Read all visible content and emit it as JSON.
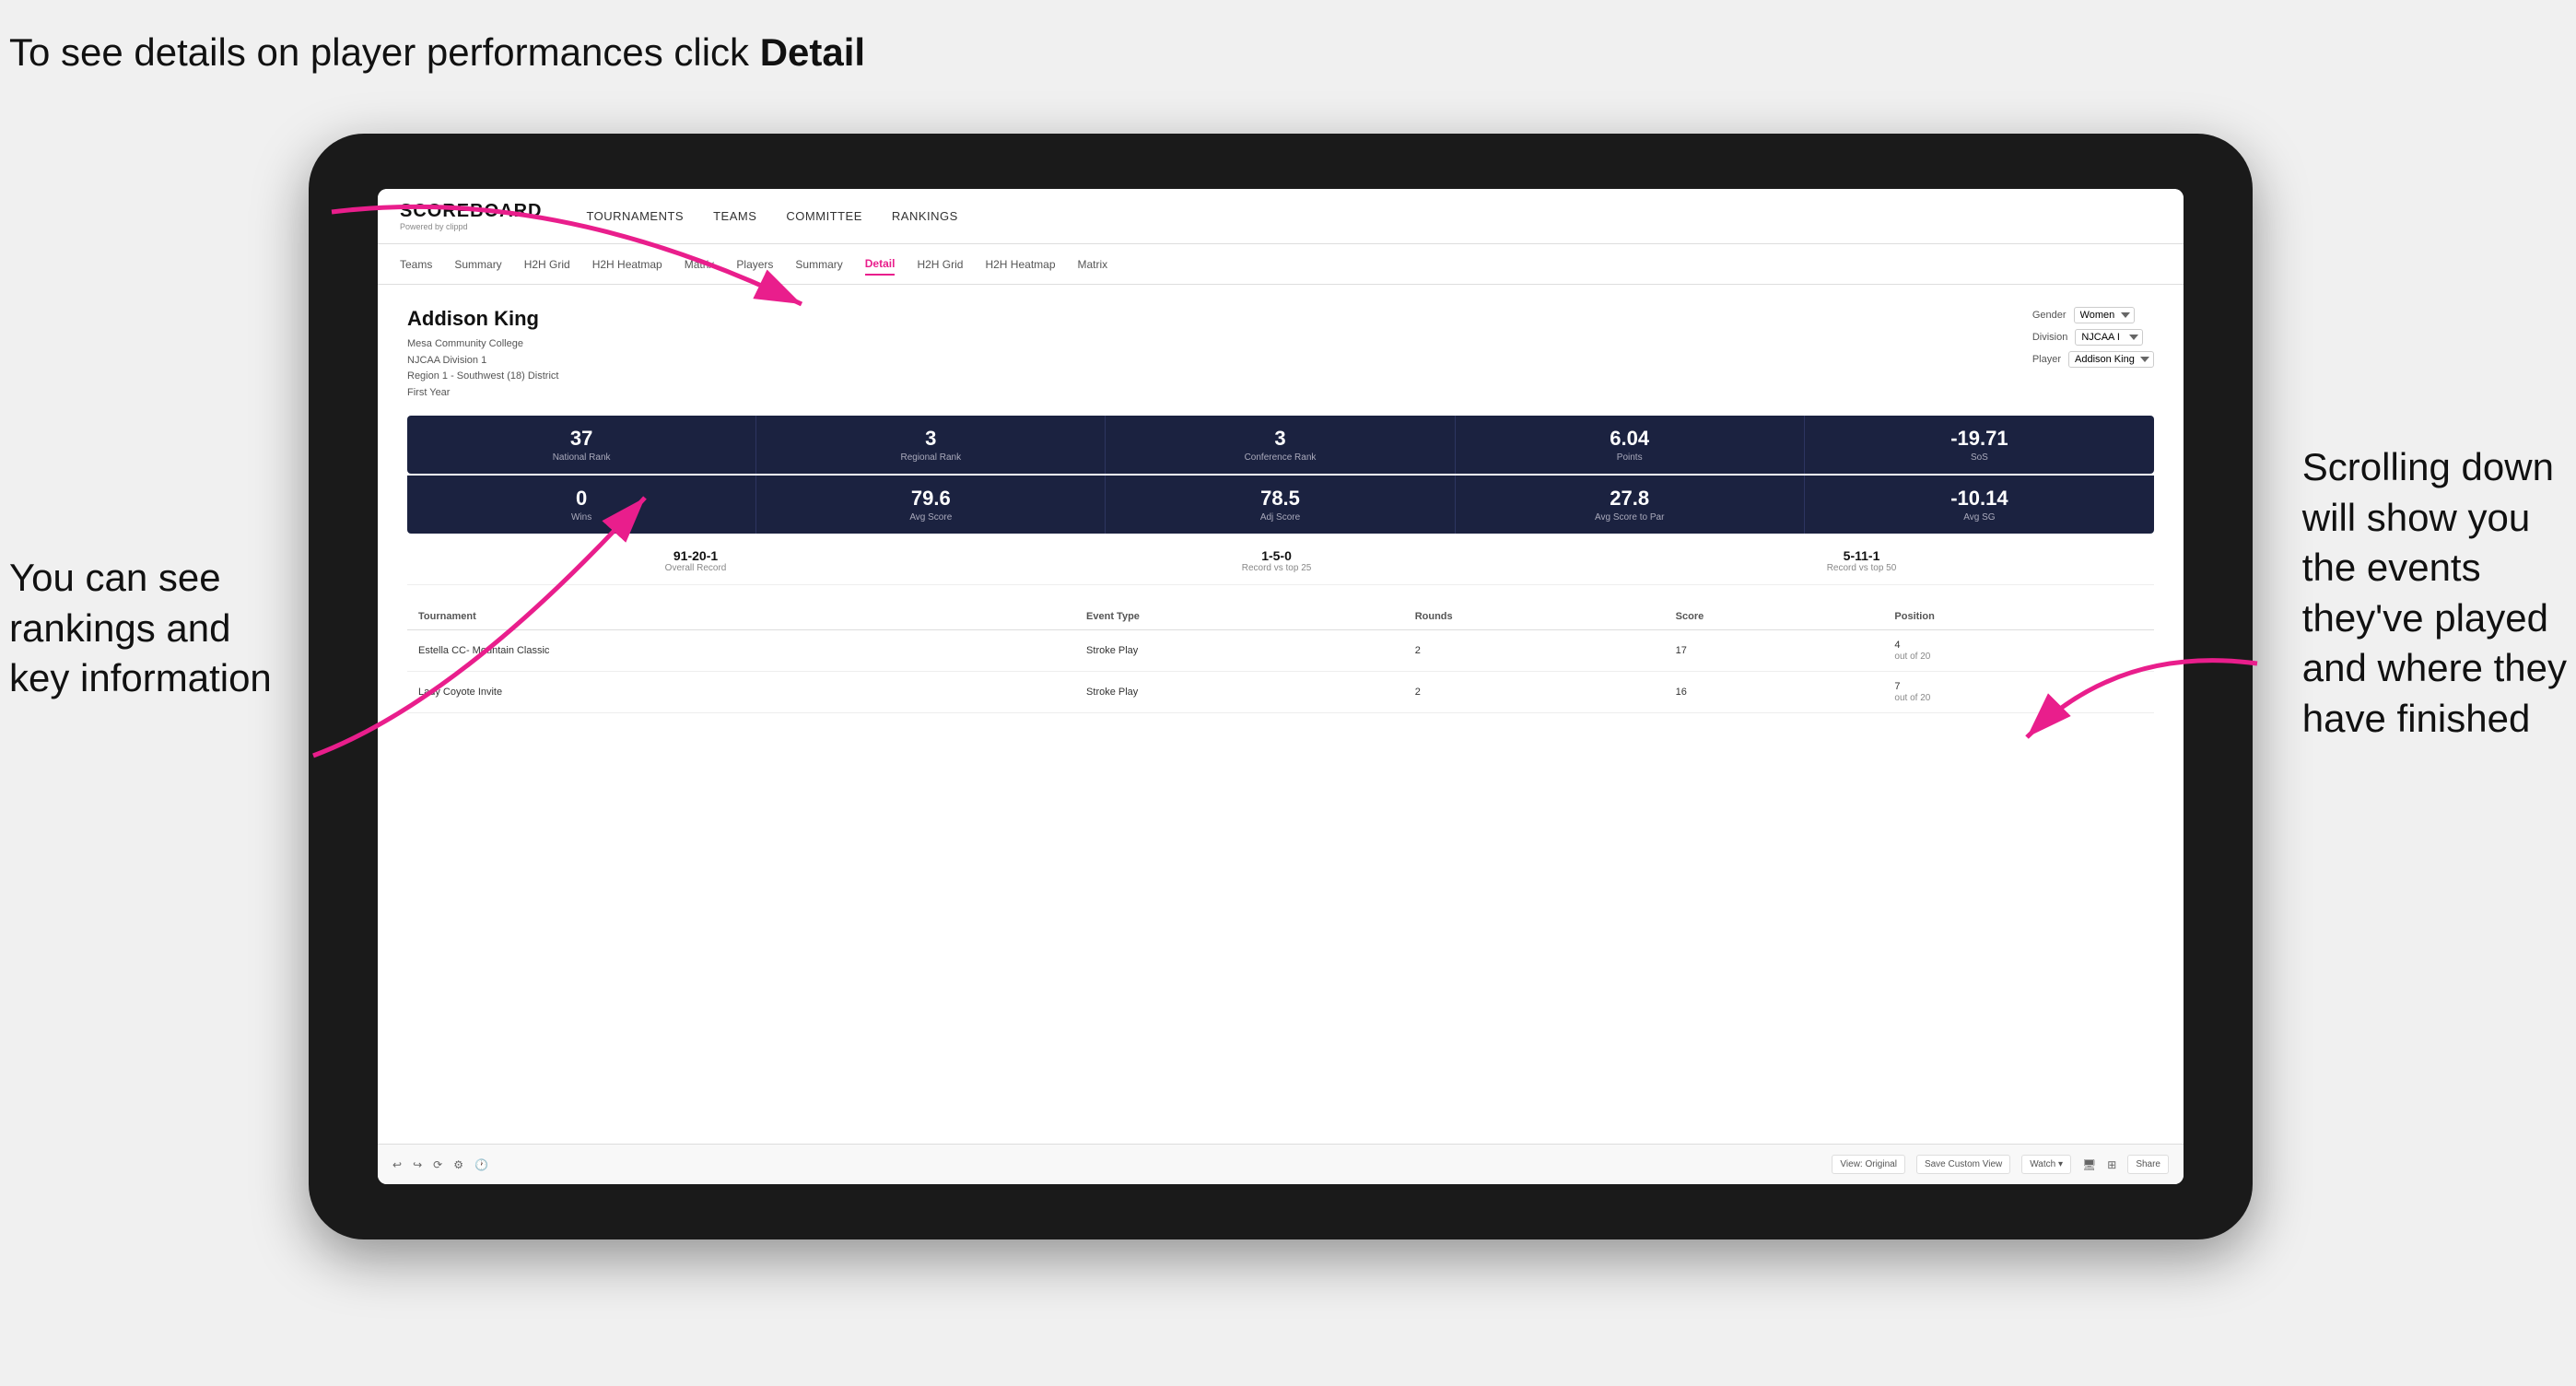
{
  "annotations": {
    "top_left": "To see details on\nplayer performances\nclick ",
    "top_left_bold": "Detail",
    "bottom_left_line1": "You can see",
    "bottom_left_line2": "rankings and",
    "bottom_left_line3": "key information",
    "right_line1": "Scrolling down",
    "right_line2": "will show you",
    "right_line3": "the events",
    "right_line4": "they've played",
    "right_line5": "and where they",
    "right_line6": "have finished"
  },
  "nav": {
    "logo_main": "SCOREBOARD",
    "logo_sub": "Powered by clippd",
    "items": [
      "TOURNAMENTS",
      "TEAMS",
      "COMMITTEE",
      "RANKINGS"
    ]
  },
  "subnav": {
    "items": [
      "Teams",
      "Summary",
      "H2H Grid",
      "H2H Heatmap",
      "Matrix",
      "Players",
      "Summary",
      "Detail",
      "H2H Grid",
      "H2H Heatmap",
      "Matrix"
    ],
    "active": "Detail"
  },
  "player": {
    "name": "Addison King",
    "school": "Mesa Community College",
    "division": "NJCAA Division 1",
    "region": "Region 1 - Southwest (18) District",
    "year": "First Year"
  },
  "filters": {
    "gender_label": "Gender",
    "gender_value": "Women",
    "division_label": "Division",
    "division_value": "NJCAA I",
    "player_label": "Player",
    "player_value": "Addison King"
  },
  "stats_row1": [
    {
      "value": "37",
      "label": "National Rank"
    },
    {
      "value": "3",
      "label": "Regional Rank"
    },
    {
      "value": "3",
      "label": "Conference Rank"
    },
    {
      "value": "6.04",
      "label": "Points"
    },
    {
      "value": "-19.71",
      "label": "SoS"
    }
  ],
  "stats_row2": [
    {
      "value": "0",
      "label": "Wins"
    },
    {
      "value": "79.6",
      "label": "Avg Score"
    },
    {
      "value": "78.5",
      "label": "Adj Score"
    },
    {
      "value": "27.8",
      "label": "Avg Score to Par"
    },
    {
      "value": "-10.14",
      "label": "Avg SG"
    }
  ],
  "records": [
    {
      "value": "91-20-1",
      "label": "Overall Record"
    },
    {
      "value": "1-5-0",
      "label": "Record vs top 25"
    },
    {
      "value": "5-11-1",
      "label": "Record vs top 50"
    }
  ],
  "table": {
    "headers": [
      "Tournament",
      "Event Type",
      "Rounds",
      "Score",
      "Position"
    ],
    "rows": [
      {
        "tournament": "Estella CC- Mountain Classic",
        "event_type": "Stroke Play",
        "rounds": "2",
        "score": "17",
        "position": "4\nout of 20"
      },
      {
        "tournament": "Lady Coyote Invite",
        "event_type": "Stroke Play",
        "rounds": "2",
        "score": "16",
        "position": "7\nout of 20"
      }
    ]
  },
  "toolbar": {
    "buttons": [
      "View: Original",
      "Save Custom View",
      "Watch ▾",
      "Share"
    ]
  }
}
